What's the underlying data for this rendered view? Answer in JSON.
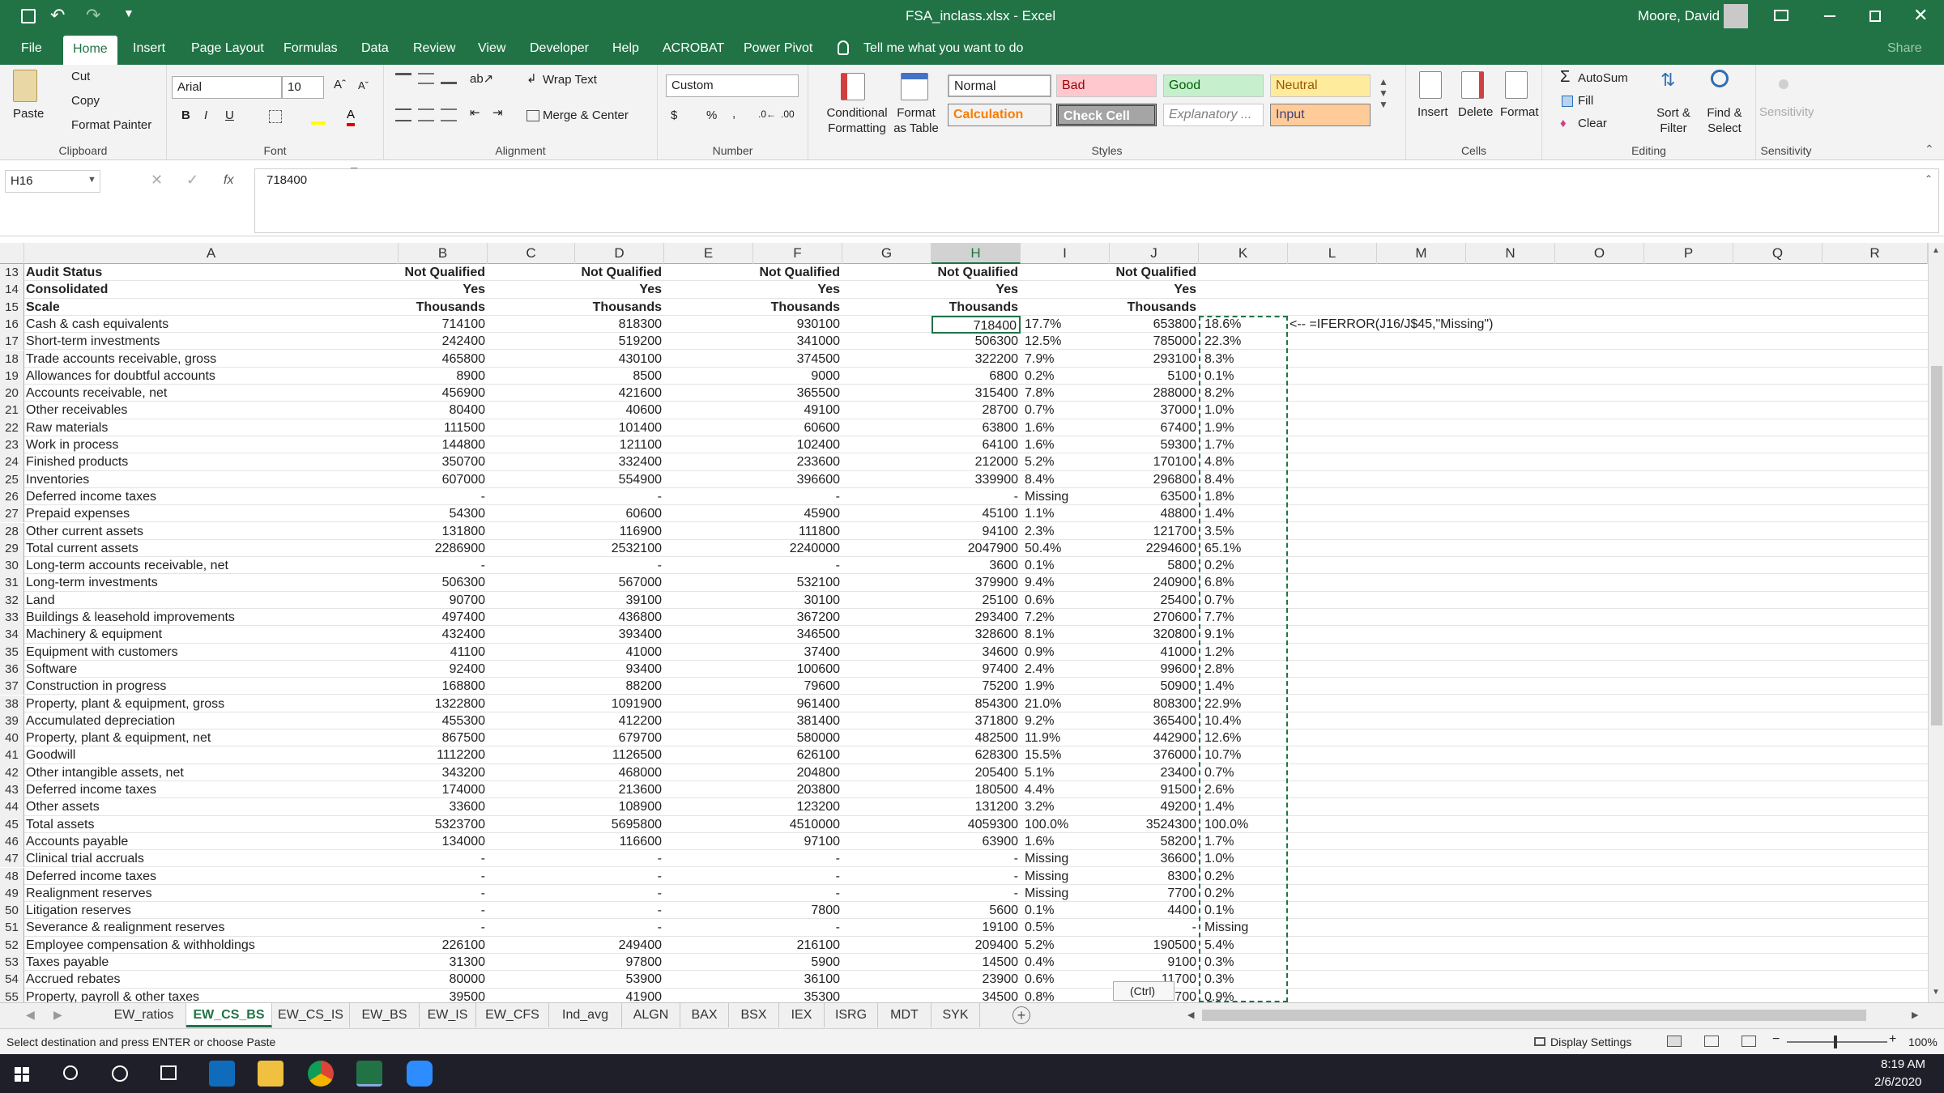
{
  "title": {
    "doc": "FSA_inclass.xlsx - Excel",
    "user": "Moore, David"
  },
  "tabs": [
    "File",
    "Home",
    "Insert",
    "Page Layout",
    "Formulas",
    "Data",
    "Review",
    "View",
    "Developer",
    "Help",
    "ACROBAT",
    "Power Pivot"
  ],
  "tell_me": "Tell me what you want to do",
  "share": "Share",
  "clipboard": {
    "paste": "Paste",
    "cut": "Cut",
    "copy": "Copy",
    "format_painter": "Format Painter",
    "label": "Clipboard"
  },
  "font": {
    "name": "Arial",
    "size": "10",
    "label": "Font",
    "bold": "B",
    "italic": "I",
    "underline": "U"
  },
  "alignment": {
    "wrap": "Wrap Text",
    "merge": "Merge & Center",
    "label": "Alignment"
  },
  "number": {
    "format": "Custom",
    "currency": "$",
    "percent": "%",
    "comma": ",",
    "label": "Number"
  },
  "styles": {
    "cond": "Conditional Formatting",
    "table": "Format as Table",
    "normal": "Normal",
    "bad": "Bad",
    "good": "Good",
    "neutral": "Neutral",
    "calculation": "Calculation",
    "check": "Check Cell",
    "explanatory": "Explanatory ...",
    "input": "Input",
    "label": "Styles"
  },
  "cells": {
    "insert": "Insert",
    "delete": "Delete",
    "format": "Format",
    "label": "Cells"
  },
  "editing": {
    "autosum": "AutoSum",
    "fill": "Fill",
    "clear": "Clear",
    "sort": "Sort & Filter",
    "find": "Find & Select",
    "label": "Editing"
  },
  "sensitivity": {
    "btn": "Sensitivity",
    "label": "Sensitivity"
  },
  "formula_bar": {
    "name_box": "H16",
    "fx": "fx",
    "value": "718400"
  },
  "columns": [
    "A",
    "B",
    "C",
    "D",
    "E",
    "F",
    "G",
    "H",
    "I",
    "J",
    "K",
    "L",
    "M",
    "N",
    "O",
    "P",
    "Q",
    "R"
  ],
  "rows": [
    {
      "n": "13",
      "a": "Audit Status",
      "b": "Not Qualified",
      "d": "Not Qualified",
      "f": "Not Qualified",
      "h": "Not Qualified",
      "i": "",
      "j": "Not Qualified",
      "k": "",
      "bold": true
    },
    {
      "n": "14",
      "a": "Consolidated",
      "b": "Yes",
      "d": "Yes",
      "f": "Yes",
      "h": "Yes",
      "i": "",
      "j": "Yes",
      "k": "",
      "bold": true
    },
    {
      "n": "15",
      "a": "Scale",
      "b": "Thousands",
      "d": "Thousands",
      "f": "Thousands",
      "h": "Thousands",
      "i": "",
      "j": "Thousands",
      "k": "",
      "bold": true
    },
    {
      "n": "16",
      "a": "Cash & cash equivalents",
      "b": "714100",
      "d": "818300",
      "f": "930100",
      "h": "718400",
      "i": "17.7%",
      "j": "653800",
      "k": "18.6%"
    },
    {
      "n": "17",
      "a": "Short-term investments",
      "b": "242400",
      "d": "519200",
      "f": "341000",
      "h": "506300",
      "i": "12.5%",
      "j": "785000",
      "k": "22.3%"
    },
    {
      "n": "18",
      "a": "Trade accounts receivable, gross",
      "b": "465800",
      "d": "430100",
      "f": "374500",
      "h": "322200",
      "i": "7.9%",
      "j": "293100",
      "k": "8.3%"
    },
    {
      "n": "19",
      "a": "Allowances for doubtful accounts",
      "b": "8900",
      "d": "8500",
      "f": "9000",
      "h": "6800",
      "i": "0.2%",
      "j": "5100",
      "k": "0.1%"
    },
    {
      "n": "20",
      "a": "Accounts receivable, net",
      "b": "456900",
      "d": "421600",
      "f": "365500",
      "h": "315400",
      "i": "7.8%",
      "j": "288000",
      "k": "8.2%"
    },
    {
      "n": "21",
      "a": "Other receivables",
      "b": "80400",
      "d": "40600",
      "f": "49100",
      "h": "28700",
      "i": "0.7%",
      "j": "37000",
      "k": "1.0%"
    },
    {
      "n": "22",
      "a": "Raw materials",
      "b": "111500",
      "d": "101400",
      "f": "60600",
      "h": "63800",
      "i": "1.6%",
      "j": "67400",
      "k": "1.9%"
    },
    {
      "n": "23",
      "a": "Work in process",
      "b": "144800",
      "d": "121100",
      "f": "102400",
      "h": "64100",
      "i": "1.6%",
      "j": "59300",
      "k": "1.7%"
    },
    {
      "n": "24",
      "a": "Finished products",
      "b": "350700",
      "d": "332400",
      "f": "233600",
      "h": "212000",
      "i": "5.2%",
      "j": "170100",
      "k": "4.8%"
    },
    {
      "n": "25",
      "a": "Inventories",
      "b": "607000",
      "d": "554900",
      "f": "396600",
      "h": "339900",
      "i": "8.4%",
      "j": "296800",
      "k": "8.4%"
    },
    {
      "n": "26",
      "a": "Deferred income taxes",
      "b": "-",
      "d": "-",
      "f": "-",
      "h": "-",
      "i": "Missing",
      "j": "63500",
      "k": "1.8%"
    },
    {
      "n": "27",
      "a": "Prepaid expenses",
      "b": "54300",
      "d": "60600",
      "f": "45900",
      "h": "45100",
      "i": "1.1%",
      "j": "48800",
      "k": "1.4%"
    },
    {
      "n": "28",
      "a": "Other current assets",
      "b": "131800",
      "d": "116900",
      "f": "111800",
      "h": "94100",
      "i": "2.3%",
      "j": "121700",
      "k": "3.5%"
    },
    {
      "n": "29",
      "a": "Total current assets",
      "b": "2286900",
      "d": "2532100",
      "f": "2240000",
      "h": "2047900",
      "i": "50.4%",
      "j": "2294600",
      "k": "65.1%"
    },
    {
      "n": "30",
      "a": "Long-term accounts receivable, net",
      "b": "-",
      "d": "-",
      "f": "-",
      "h": "3600",
      "i": "0.1%",
      "j": "5800",
      "k": "0.2%"
    },
    {
      "n": "31",
      "a": "Long-term investments",
      "b": "506300",
      "d": "567000",
      "f": "532100",
      "h": "379900",
      "i": "9.4%",
      "j": "240900",
      "k": "6.8%"
    },
    {
      "n": "32",
      "a": "Land",
      "b": "90700",
      "d": "39100",
      "f": "30100",
      "h": "25100",
      "i": "0.6%",
      "j": "25400",
      "k": "0.7%"
    },
    {
      "n": "33",
      "a": "Buildings & leasehold improvements",
      "b": "497400",
      "d": "436800",
      "f": "367200",
      "h": "293400",
      "i": "7.2%",
      "j": "270600",
      "k": "7.7%"
    },
    {
      "n": "34",
      "a": "Machinery & equipment",
      "b": "432400",
      "d": "393400",
      "f": "346500",
      "h": "328600",
      "i": "8.1%",
      "j": "320800",
      "k": "9.1%"
    },
    {
      "n": "35",
      "a": "Equipment with customers",
      "b": "41100",
      "d": "41000",
      "f": "37400",
      "h": "34600",
      "i": "0.9%",
      "j": "41000",
      "k": "1.2%"
    },
    {
      "n": "36",
      "a": "Software",
      "b": "92400",
      "d": "93400",
      "f": "100600",
      "h": "97400",
      "i": "2.4%",
      "j": "99600",
      "k": "2.8%"
    },
    {
      "n": "37",
      "a": "Construction in progress",
      "b": "168800",
      "d": "88200",
      "f": "79600",
      "h": "75200",
      "i": "1.9%",
      "j": "50900",
      "k": "1.4%"
    },
    {
      "n": "38",
      "a": "Property, plant & equipment, gross",
      "b": "1322800",
      "d": "1091900",
      "f": "961400",
      "h": "854300",
      "i": "21.0%",
      "j": "808300",
      "k": "22.9%"
    },
    {
      "n": "39",
      "a": "Accumulated depreciation",
      "b": "455300",
      "d": "412200",
      "f": "381400",
      "h": "371800",
      "i": "9.2%",
      "j": "365400",
      "k": "10.4%"
    },
    {
      "n": "40",
      "a": "Property, plant & equipment, net",
      "b": "867500",
      "d": "679700",
      "f": "580000",
      "h": "482500",
      "i": "11.9%",
      "j": "442900",
      "k": "12.6%"
    },
    {
      "n": "41",
      "a": "Goodwill",
      "b": "1112200",
      "d": "1126500",
      "f": "626100",
      "h": "628300",
      "i": "15.5%",
      "j": "376000",
      "k": "10.7%"
    },
    {
      "n": "42",
      "a": "Other intangible assets, net",
      "b": "343200",
      "d": "468000",
      "f": "204800",
      "h": "205400",
      "i": "5.1%",
      "j": "23400",
      "k": "0.7%"
    },
    {
      "n": "43",
      "a": "Deferred income taxes",
      "b": "174000",
      "d": "213600",
      "f": "203800",
      "h": "180500",
      "i": "4.4%",
      "j": "91500",
      "k": "2.6%"
    },
    {
      "n": "44",
      "a": "Other assets",
      "b": "33600",
      "d": "108900",
      "f": "123200",
      "h": "131200",
      "i": "3.2%",
      "j": "49200",
      "k": "1.4%"
    },
    {
      "n": "45",
      "a": "Total assets",
      "b": "5323700",
      "d": "5695800",
      "f": "4510000",
      "h": "4059300",
      "i": "100.0%",
      "j": "3524300",
      "k": "100.0%"
    },
    {
      "n": "46",
      "a": "Accounts payable",
      "b": "134000",
      "d": "116600",
      "f": "97100",
      "h": "63900",
      "i": "1.6%",
      "j": "58200",
      "k": "1.7%"
    },
    {
      "n": "47",
      "a": "Clinical trial accruals",
      "b": "-",
      "d": "-",
      "f": "-",
      "h": "-",
      "i": "Missing",
      "j": "36600",
      "k": "1.0%"
    },
    {
      "n": "48",
      "a": "Deferred income taxes",
      "b": "-",
      "d": "-",
      "f": "-",
      "h": "-",
      "i": "Missing",
      "j": "8300",
      "k": "0.2%"
    },
    {
      "n": "49",
      "a": "Realignment reserves",
      "b": "-",
      "d": "-",
      "f": "-",
      "h": "-",
      "i": "Missing",
      "j": "7700",
      "k": "0.2%"
    },
    {
      "n": "50",
      "a": "Litigation reserves",
      "b": "-",
      "d": "-",
      "f": "7800",
      "h": "5600",
      "i": "0.1%",
      "j": "4400",
      "k": "0.1%"
    },
    {
      "n": "51",
      "a": "Severance & realignment reserves",
      "b": "-",
      "d": "-",
      "f": "-",
      "h": "19100",
      "i": "0.5%",
      "j": "-",
      "k": "Missing"
    },
    {
      "n": "52",
      "a": "Employee compensation & withholdings",
      "b": "226100",
      "d": "249400",
      "f": "216100",
      "h": "209400",
      "i": "5.2%",
      "j": "190500",
      "k": "5.4%"
    },
    {
      "n": "53",
      "a": "Taxes payable",
      "b": "31300",
      "d": "97800",
      "f": "5900",
      "h": "14500",
      "i": "0.4%",
      "j": "9100",
      "k": "0.3%"
    },
    {
      "n": "54",
      "a": "Accrued rebates",
      "b": "80000",
      "d": "53900",
      "f": "36100",
      "h": "23900",
      "i": "0.6%",
      "j": "11700",
      "k": "0.3%"
    },
    {
      "n": "55",
      "a": "Property, payroll & other taxes",
      "b": "39500",
      "d": "41900",
      "f": "35300",
      "h": "34500",
      "i": "0.8%",
      "j": "700",
      "k": "0.9%"
    }
  ],
  "annotation": "<--  =IFERROR(J16/J$45,\"Missing\")",
  "ctrl_tag": "(Ctrl)",
  "sheets": [
    "EW_ratios",
    "EW_CS_BS",
    "EW_CS_IS",
    "EW_BS",
    "EW_IS",
    "EW_CFS",
    "Ind_avg",
    "ALGN",
    "BAX",
    "BSX",
    "IEX",
    "ISRG",
    "MDT",
    "SYK"
  ],
  "active_sheet": "EW_CS_BS",
  "status": {
    "msg": "Select destination and press ENTER or choose Paste",
    "display": "Display Settings",
    "zoom": "100%"
  },
  "clock": {
    "time": "8:19 AM",
    "date": "2/6/2020"
  },
  "colors": {
    "excel_green": "#217346",
    "taskbar": "#1f1f2a"
  }
}
